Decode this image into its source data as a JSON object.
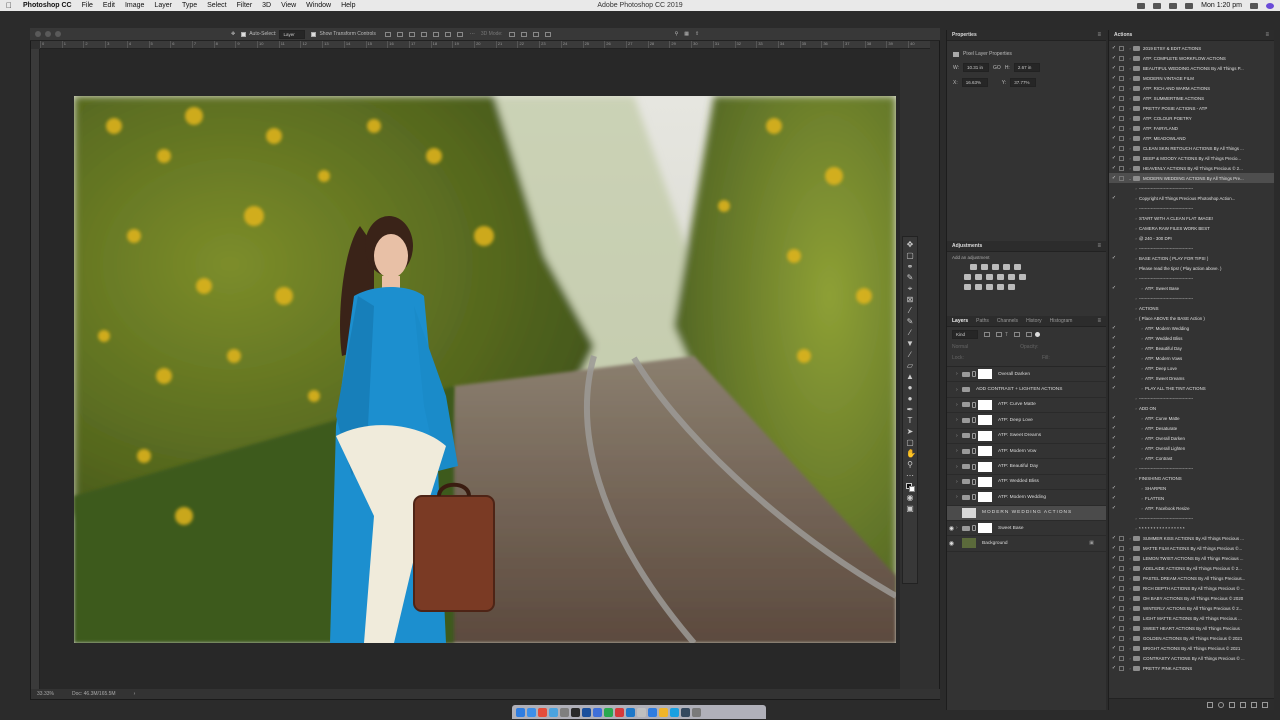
{
  "menubar": {
    "app_name": "Photoshop CC",
    "menus": [
      "File",
      "Edit",
      "Image",
      "Layer",
      "Type",
      "Select",
      "Filter",
      "3D",
      "View",
      "Window",
      "Help"
    ],
    "window_title": "Adobe Photoshop CC 2019",
    "clock": "Mon 1:20 pm"
  },
  "options_bar": {
    "auto_select_label": "Auto-Select:",
    "auto_select_value": "Layer",
    "transform_controls_label": "Show Transform Controls",
    "mode_3d": "3D Mode:"
  },
  "ruler_ticks": [
    "0",
    "1",
    "2",
    "3",
    "4",
    "5",
    "6",
    "7",
    "8",
    "9",
    "10",
    "11",
    "12",
    "13",
    "14",
    "15",
    "16",
    "17",
    "18",
    "19",
    "20",
    "21",
    "22",
    "23",
    "24",
    "25",
    "26",
    "27",
    "28",
    "29",
    "30",
    "31",
    "32",
    "33",
    "34",
    "35",
    "36",
    "37",
    "38",
    "39",
    "40"
  ],
  "status_bar": {
    "zoom": "33.33%",
    "doc_size": "Doc: 46.3M/165.5M"
  },
  "properties": {
    "title": "Properties",
    "subtitle": "Pixel Layer Properties",
    "w_label": "W:",
    "w_value": "10.31 in",
    "link": "GO",
    "h_label": "H:",
    "h_value": "2.67 in",
    "x_label": "X:",
    "x_value": "16.63%",
    "y_label": "Y:",
    "y_value": "37.77%"
  },
  "adjustments": {
    "title": "Adjustments",
    "hint": "Add an adjustment"
  },
  "layers_panel": {
    "tabs": [
      "Layers",
      "Paths",
      "Channels",
      "History",
      "Histogram"
    ],
    "kind_label": "Kind",
    "blend_mode": "Normal",
    "opacity_label": "Opacity:",
    "lock_label": "Lock:",
    "fill_label": "Fill:",
    "rows": [
      {
        "name": "Overall Darken",
        "type": "layer"
      },
      {
        "name": "ADD CONTRAST + LIGHTEN ACTIONS",
        "type": "folder"
      },
      {
        "name": "ATP: Curve Matte",
        "type": "layer"
      },
      {
        "name": "ATP: Deep Love",
        "type": "layer"
      },
      {
        "name": "ATP: Sweet Dreams",
        "type": "layer"
      },
      {
        "name": "ATP: Modern Vow",
        "type": "layer"
      },
      {
        "name": "ATP: Beautiful Day",
        "type": "layer"
      },
      {
        "name": "ATP: Wedded Bliss",
        "type": "layer"
      },
      {
        "name": "ATP: Modern Wedding",
        "type": "layer"
      },
      {
        "name": "MODERN WEDDING ACTIONS",
        "type": "label"
      },
      {
        "name": "Sweet Base",
        "type": "layer"
      },
      {
        "name": "Background",
        "type": "background"
      }
    ]
  },
  "actions_panel": {
    "title": "Actions",
    "rows": [
      {
        "text": "2019 ETSY & EDIT ACTIONS",
        "indent": 0,
        "check": true,
        "folder": true
      },
      {
        "text": "ATP: COMPLETE WORKFLOW ACTIONS",
        "indent": 0,
        "check": true,
        "folder": true
      },
      {
        "text": "BEAUTIFUL WEDDING ACTIONS By All Things P...",
        "indent": 0,
        "check": true,
        "folder": true
      },
      {
        "text": "MODERN VINTAGE FILM",
        "indent": 0,
        "check": true,
        "folder": true
      },
      {
        "text": "ATP: RICH AND WARM ACTIONS",
        "indent": 0,
        "check": true,
        "folder": true
      },
      {
        "text": "ATP: SUMMERTIME ACTIONS",
        "indent": 0,
        "check": true,
        "folder": true
      },
      {
        "text": "PRETTY POSIE ACTIONS - ATP",
        "indent": 0,
        "check": true,
        "folder": true
      },
      {
        "text": "ATP: COLOUR POETRY",
        "indent": 0,
        "check": true,
        "folder": true
      },
      {
        "text": "ATP: FAIRYLAND",
        "indent": 0,
        "check": true,
        "folder": true
      },
      {
        "text": "ATP: MEADOWLAND",
        "indent": 0,
        "check": true,
        "folder": true
      },
      {
        "text": "CLEAN SKIN RETOUCH ACTIONS By All Things ...",
        "indent": 0,
        "check": true,
        "folder": true
      },
      {
        "text": "DEEP & MOODY ACTIONS By All Things Precio...",
        "indent": 0,
        "check": true,
        "folder": true
      },
      {
        "text": "HEAVENLY ACTIONS By All Things Precious © 2...",
        "indent": 0,
        "check": true,
        "folder": true
      },
      {
        "text": "MODERN WEDDING ACTIONS By All Things Pre...",
        "indent": 0,
        "check": true,
        "folder": true,
        "selected": true
      },
      {
        "text": "-------------------------------------",
        "indent": 1,
        "check": false,
        "folder": false
      },
      {
        "text": "Copyright All Things Precious Photoshop Action...",
        "indent": 1,
        "check": true,
        "folder": false
      },
      {
        "text": "-------------------------------------",
        "indent": 1,
        "check": false,
        "folder": false
      },
      {
        "text": "START WITH A CLEAN FLAT IMAGE!",
        "indent": 1,
        "check": false,
        "folder": false
      },
      {
        "text": "CAMERA RAW FILES WORK BEST",
        "indent": 1,
        "check": false,
        "folder": false
      },
      {
        "text": "@ 240 - 300 DPI",
        "indent": 1,
        "check": false,
        "folder": false
      },
      {
        "text": "-------------------------------------",
        "indent": 1,
        "check": false,
        "folder": false
      },
      {
        "text": "BASE ACTION ( PLAY FOR TIPS! )",
        "indent": 1,
        "check": true,
        "folder": false
      },
      {
        "text": "Please read the tips! ( Play action above. )",
        "indent": 1,
        "check": false,
        "folder": false
      },
      {
        "text": "-------------------------------------",
        "indent": 1,
        "check": false,
        "folder": false
      },
      {
        "text": "ATP: Sweet Base",
        "indent": 2,
        "check": true,
        "folder": false
      },
      {
        "text": "-------------------------------------",
        "indent": 1,
        "check": false,
        "folder": false
      },
      {
        "text": "ACTIONS",
        "indent": 1,
        "check": false,
        "folder": false
      },
      {
        "text": "( Place ABOVE the BASE Action )",
        "indent": 1,
        "check": false,
        "folder": false
      },
      {
        "text": "ATP: Modern Wedding",
        "indent": 2,
        "check": true,
        "folder": false
      },
      {
        "text": "ATP: Wedded Bliss",
        "indent": 2,
        "check": true,
        "folder": false
      },
      {
        "text": "ATP: Beautiful Day",
        "indent": 2,
        "check": true,
        "folder": false
      },
      {
        "text": "ATP: Modern Vows",
        "indent": 2,
        "check": true,
        "folder": false
      },
      {
        "text": "ATP: Deep Love",
        "indent": 2,
        "check": true,
        "folder": false
      },
      {
        "text": "ATP: Sweet Dreams",
        "indent": 2,
        "check": true,
        "folder": false
      },
      {
        "text": "PLAY ALL THE TINT ACTIONS",
        "indent": 2,
        "check": true,
        "folder": false
      },
      {
        "text": "-------------------------------------",
        "indent": 1,
        "check": false,
        "folder": false
      },
      {
        "text": "ADD ON",
        "indent": 1,
        "check": false,
        "folder": false
      },
      {
        "text": "ATP: Curve Matte",
        "indent": 2,
        "check": true,
        "folder": false
      },
      {
        "text": "ATP: Desaturate",
        "indent": 2,
        "check": true,
        "folder": false
      },
      {
        "text": "ATP: Overall Darken",
        "indent": 2,
        "check": true,
        "folder": false
      },
      {
        "text": "ATP: Overall Lighten",
        "indent": 2,
        "check": true,
        "folder": false
      },
      {
        "text": "ATP: Contrast",
        "indent": 2,
        "check": true,
        "folder": false
      },
      {
        "text": "-------------------------------------",
        "indent": 1,
        "check": false,
        "folder": false
      },
      {
        "text": "FINISHING ACTIONS",
        "indent": 1,
        "check": false,
        "folder": false
      },
      {
        "text": "SHARPEN",
        "indent": 2,
        "check": true,
        "folder": false
      },
      {
        "text": "FLATTEN",
        "indent": 2,
        "check": true,
        "folder": false
      },
      {
        "text": "ATP: Facebook Resize",
        "indent": 2,
        "check": true,
        "folder": false
      },
      {
        "text": "-------------------------------------",
        "indent": 1,
        "check": false,
        "folder": false
      },
      {
        "text": "* * * * * * * * * * * * * * * *",
        "indent": 1,
        "check": false,
        "folder": false
      },
      {
        "text": "SUMMER KISS ACTIONS By All Things Precious ...",
        "indent": 0,
        "check": true,
        "folder": true
      },
      {
        "text": "MATTE FILM ACTIONS By All Things Precious ©...",
        "indent": 0,
        "check": true,
        "folder": true
      },
      {
        "text": "LEMON TWIST ACTIONS By All Things Precious ...",
        "indent": 0,
        "check": true,
        "folder": true
      },
      {
        "text": "ADELAIDE ACTIONS By All Things Precious © 2...",
        "indent": 0,
        "check": true,
        "folder": true
      },
      {
        "text": "PASTEL DREAM ACTIONS By All Things Precious...",
        "indent": 0,
        "check": true,
        "folder": true
      },
      {
        "text": "RICH DEPTH ACTIONS By All Things Precious © ...",
        "indent": 0,
        "check": true,
        "folder": true
      },
      {
        "text": "OH BABY ACTIONS By All Things Precious © 2020",
        "indent": 0,
        "check": true,
        "folder": true
      },
      {
        "text": "WINTERLY ACTIONS By All Things Precious © 2...",
        "indent": 0,
        "check": true,
        "folder": true
      },
      {
        "text": "LIGHT MATTE ACTIONS By All Things Precious ...",
        "indent": 0,
        "check": true,
        "folder": true
      },
      {
        "text": "SWEET HEART ACTIONS By All Things Precious",
        "indent": 0,
        "check": true,
        "folder": true
      },
      {
        "text": "GOLDEN ACTIONS By All Things Precious © 2021",
        "indent": 0,
        "check": true,
        "folder": true
      },
      {
        "text": "BRIGHT ACTIONS By All Things Precious © 2021",
        "indent": 0,
        "check": true,
        "folder": true
      },
      {
        "text": "CONTRASTY ACTIONS By All Things Precious © ...",
        "indent": 0,
        "check": true,
        "folder": true
      },
      {
        "text": "PRETTY PINK ACTIONS",
        "indent": 0,
        "check": true,
        "folder": true
      }
    ]
  },
  "dock_colors": [
    "#2f7de1",
    "#3d8fe8",
    "#e44d3a",
    "#4aa3df",
    "#7f7f7f",
    "#2a2a2a",
    "#1a4f9c",
    "#3f6fd8",
    "#2aa84f",
    "#d43a3a",
    "#1e78c8",
    "#c0c0c0",
    "#2f7de1",
    "#f0b429",
    "#1aa0e0",
    "#34495e",
    "#7a7a7a"
  ]
}
